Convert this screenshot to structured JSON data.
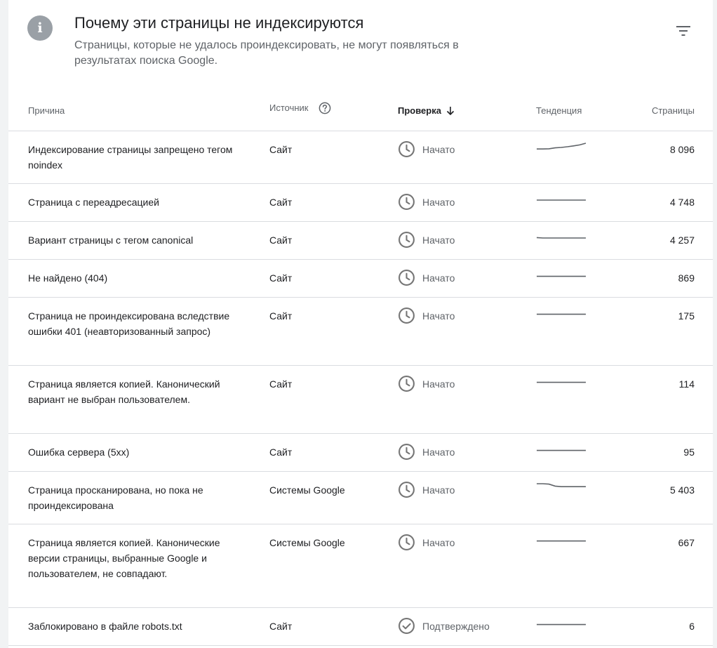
{
  "header": {
    "title": "Почему эти страницы не индексируются",
    "subtitle": "Страницы, которые не удалось проиндексировать, не могут появляться в результатах поиска Google."
  },
  "columns": {
    "reason": "Причина",
    "source": "Источник",
    "check": "Проверка",
    "trend": "Тенденция",
    "pages": "Страницы"
  },
  "rows": [
    {
      "reason": "Индексирование страницы запрещено тегом noindex",
      "source": "Сайт",
      "status": "Начато",
      "status_icon": "clock-icon",
      "pages": "8 096",
      "trend": [
        0.32,
        0.32,
        0.34,
        0.45,
        0.5,
        0.58,
        0.68,
        0.8,
        1.0
      ]
    },
    {
      "reason": "Страница с переадресацией",
      "source": "Сайт",
      "status": "Начато",
      "status_icon": "clock-icon",
      "pages": "4 748",
      "trend": [
        0.5,
        0.5,
        0.5,
        0.5,
        0.5,
        0.5,
        0.5,
        0.5,
        0.5
      ]
    },
    {
      "reason": "Вариант страницы с тегом canonical",
      "source": "Сайт",
      "status": "Начато",
      "status_icon": "clock-icon",
      "pages": "4 257",
      "trend": [
        0.55,
        0.5,
        0.5,
        0.5,
        0.5,
        0.5,
        0.5,
        0.5,
        0.5
      ]
    },
    {
      "reason": "Не найдено (404)",
      "source": "Сайт",
      "status": "Начато",
      "status_icon": "clock-icon",
      "pages": "869",
      "trend": [
        0.45,
        0.45,
        0.45,
        0.45,
        0.45,
        0.45,
        0.45,
        0.45,
        0.45
      ]
    },
    {
      "reason": "Страница не проиндексирована вследствие ошибки 401 (неавторизованный запрос)",
      "source": "Сайт",
      "status": "Начато",
      "status_icon": "clock-icon",
      "pages": "175",
      "trend": [
        0.45,
        0.45,
        0.45,
        0.45,
        0.45,
        0.45,
        0.45,
        0.45,
        0.45
      ]
    },
    {
      "reason": "Страница является копией. Канонический вариант не выбран пользователем.",
      "source": "Сайт",
      "status": "Начато",
      "status_icon": "clock-icon",
      "pages": "114",
      "trend": [
        0.45,
        0.45,
        0.45,
        0.45,
        0.45,
        0.45,
        0.45,
        0.45,
        0.45
      ]
    },
    {
      "reason": "Ошибка сервера (5xx)",
      "source": "Сайт",
      "status": "Начато",
      "status_icon": "clock-icon",
      "pages": "95",
      "trend": [
        0.45,
        0.45,
        0.45,
        0.45,
        0.45,
        0.45,
        0.45,
        0.45,
        0.45
      ]
    },
    {
      "reason": "Страница просканирована, но пока не проиндексирована",
      "source": "Системы Google",
      "status": "Начато",
      "status_icon": "clock-icon",
      "pages": "5 403",
      "trend": [
        1.0,
        1.0,
        0.95,
        0.72,
        0.65,
        0.65,
        0.65,
        0.65,
        0.65
      ]
    },
    {
      "reason": "Страница является копией. Канонические версии страницы, выбранные Google и пользователем, не совпадают.",
      "source": "Системы Google",
      "status": "Начато",
      "status_icon": "clock-icon",
      "pages": "667",
      "trend": [
        0.45,
        0.45,
        0.45,
        0.45,
        0.45,
        0.45,
        0.45,
        0.45,
        0.45
      ]
    },
    {
      "reason": "Заблокировано в файле robots.txt",
      "source": "Сайт",
      "status": "Подтверждено",
      "status_icon": "check-circle-icon",
      "pages": "6",
      "trend": [
        0.45,
        0.45,
        0.45,
        0.45,
        0.45,
        0.45,
        0.45,
        0.45,
        0.45
      ]
    }
  ]
}
